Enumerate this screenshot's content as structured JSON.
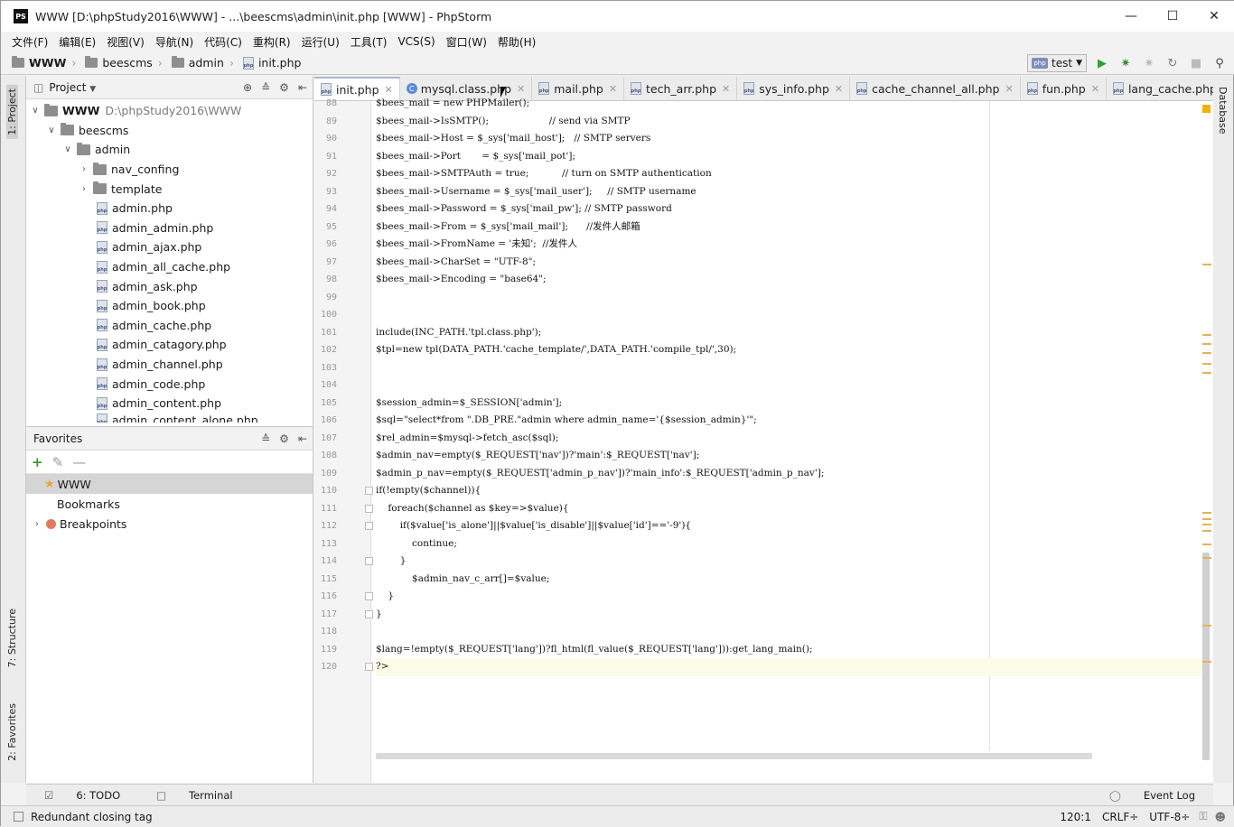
{
  "window": {
    "title": "WWW [D:\\phpStudy2016\\WWW] - ...\\beescms\\admin\\init.php [WWW] - PhpStorm",
    "app_badge": "PS"
  },
  "menu": [
    "文件(F)",
    "编辑(E)",
    "视图(V)",
    "导航(N)",
    "代码(C)",
    "重构(R)",
    "运行(U)",
    "工具(T)",
    "VCS(S)",
    "窗口(W)",
    "帮助(H)"
  ],
  "breadcrumb": [
    "WWW",
    "beescms",
    "admin",
    "init.php"
  ],
  "run_config": "test",
  "left_tool_tabs": [
    "1: Project",
    "7: Structure",
    "2: Favorites"
  ],
  "right_tool_tabs": [
    "Database"
  ],
  "project_panel": {
    "title": "Project",
    "root": "WWW",
    "root_path": "D:\\phpStudy2016\\WWW",
    "items": [
      {
        "label": "beescms",
        "type": "folder"
      },
      {
        "label": "admin",
        "type": "folder"
      },
      {
        "label": "nav_confing",
        "type": "folder"
      },
      {
        "label": "template",
        "type": "folder"
      },
      {
        "label": "admin.php",
        "type": "file"
      },
      {
        "label": "admin_admin.php",
        "type": "file"
      },
      {
        "label": "admin_ajax.php",
        "type": "file"
      },
      {
        "label": "admin_all_cache.php",
        "type": "file"
      },
      {
        "label": "admin_ask.php",
        "type": "file"
      },
      {
        "label": "admin_book.php",
        "type": "file"
      },
      {
        "label": "admin_cache.php",
        "type": "file"
      },
      {
        "label": "admin_catagory.php",
        "type": "file"
      },
      {
        "label": "admin_channel.php",
        "type": "file"
      },
      {
        "label": "admin_code.php",
        "type": "file"
      },
      {
        "label": "admin_content.php",
        "type": "file"
      },
      {
        "label": "admin_content_alone.php",
        "type": "file"
      }
    ]
  },
  "favorites_panel": {
    "title": "Favorites",
    "items": [
      {
        "label": "WWW"
      },
      {
        "label": "Bookmarks"
      },
      {
        "label": "Breakpoints"
      }
    ]
  },
  "tabs": [
    {
      "label": "init.php"
    },
    {
      "label": "mysql.class.php"
    },
    {
      "label": "mail.php"
    },
    {
      "label": "tech_arr.php"
    },
    {
      "label": "sys_info.php"
    },
    {
      "label": "cache_channel_all.php"
    },
    {
      "label": "fun.php"
    },
    {
      "label": "lang_cache.php"
    }
  ],
  "editor": {
    "line_numbers": [
      "88",
      "89",
      "90",
      "91",
      "92",
      "93",
      "94",
      "95",
      "96",
      "97",
      "98",
      "99",
      "100",
      "101",
      "102",
      "103",
      "104",
      "105",
      "106",
      "107",
      "108",
      "109",
      "110",
      "111",
      "112",
      "113",
      "114",
      "115",
      "116",
      "117",
      "118",
      "119",
      "120"
    ],
    "lines": [
      "$bees_mail = new PHPMailer();",
      "$bees_mail->IsSMTP();                    // send via SMTP",
      "$bees_mail->Host = $_sys['mail_host'];   // SMTP servers",
      "$bees_mail->Port       = $_sys['mail_pot'];",
      "$bees_mail->SMTPAuth = true;           // turn on SMTP authentication",
      "$bees_mail->Username = $_sys['mail_user'];     // SMTP username",
      "$bees_mail->Password = $_sys['mail_pw']; // SMTP password",
      "$bees_mail->From = $_sys['mail_mail'];      //发件人邮箱",
      "$bees_mail->FromName = '未知';  //发件人",
      "$bees_mail->CharSet = \"UTF-8\";",
      "$bees_mail->Encoding = \"base64\";",
      "",
      "",
      "include(INC_PATH.'tpl.class.php');",
      "$tpl=new tpl(DATA_PATH.'cache_template/',DATA_PATH.'compile_tpl/',30);",
      "",
      "",
      "$session_admin=$_SESSION['admin'];",
      "$sql=\"select*from \".DB_PRE.\"admin where admin_name='{$session_admin}'\";",
      "$rel_admin=$mysql->fetch_asc($sql);",
      "$admin_nav=empty($_REQUEST['nav'])?'main':$_REQUEST['nav'];",
      "$admin_p_nav=empty($_REQUEST['admin_p_nav'])?'main_info':$_REQUEST['admin_p_nav'];",
      "if(!empty($channel)){",
      "    foreach($channel as $key=>$value){",
      "        if($value['is_alone']||$value['is_disable']||$value['id']=='-9'){",
      "            continue;",
      "        }",
      "            $admin_nav_c_arr[]=$value;",
      "    }",
      "}",
      "",
      "$lang=!empty($_REQUEST['lang'])?fl_html(fl_value($_REQUEST['lang'])):get_lang_main();",
      "?>"
    ]
  },
  "bottom_tabs": [
    {
      "label": "6: TODO"
    },
    {
      "label": "Terminal"
    }
  ],
  "event_log": "Event Log",
  "status": {
    "message": "Redundant closing tag",
    "position": "120:1",
    "line_sep": "CRLF÷",
    "encoding": "UTF-8÷"
  }
}
